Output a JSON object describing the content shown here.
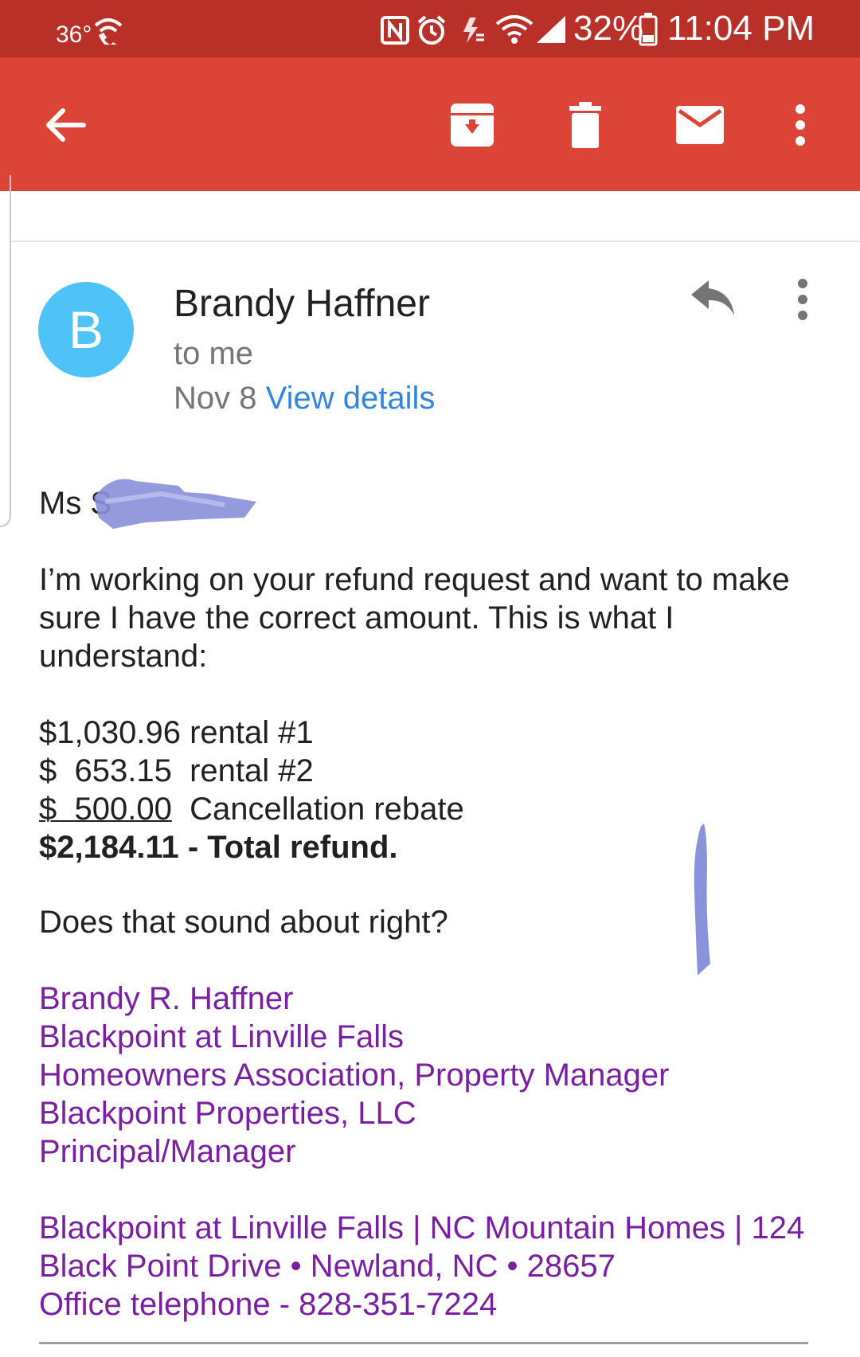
{
  "status_bar": {
    "temperature": "36°",
    "battery": "32%",
    "time": "11:04 PM"
  },
  "toolbar": {
    "icons": [
      "back-arrow-icon",
      "archive-icon",
      "trash-icon",
      "mail-icon",
      "more-vert-icon"
    ]
  },
  "email": {
    "avatar_letter": "B",
    "sender": "Brandy Haffner",
    "recipient": "to me",
    "date": "Nov 8",
    "view_details": "View details",
    "greeting": "Ms S",
    "paragraph": "I’m working on your refund request and want to make sure I have the correct amount. This is what I understand:",
    "amounts": [
      {
        "amount": "$1,030.96",
        "label": "rental #1"
      },
      {
        "amount": "$  653.15",
        "label": "rental #2"
      },
      {
        "amount": "$  500.00",
        "label": "Cancellation rebate"
      }
    ],
    "total": "$2,184.11 - Total refund.",
    "question": "Does that sound about right?",
    "signature": [
      "Brandy R. Haffner",
      "Blackpoint at Linville Falls",
      "Homeowners Association, Property Manager",
      "Blackpoint Properties, LLC",
      "Principal/Manager"
    ],
    "footer": [
      "Blackpoint at Linville Falls | NC Mountain Homes | 124",
      "Black Point Drive • Newland, NC • 28657",
      "Office telephone - 828-351-7224"
    ]
  },
  "colors": {
    "status_bar": "#b83027",
    "app_bar": "#db4437",
    "avatar": "#4fc3f7",
    "link": "#2f86e0",
    "signature": "#7b1fa2"
  }
}
